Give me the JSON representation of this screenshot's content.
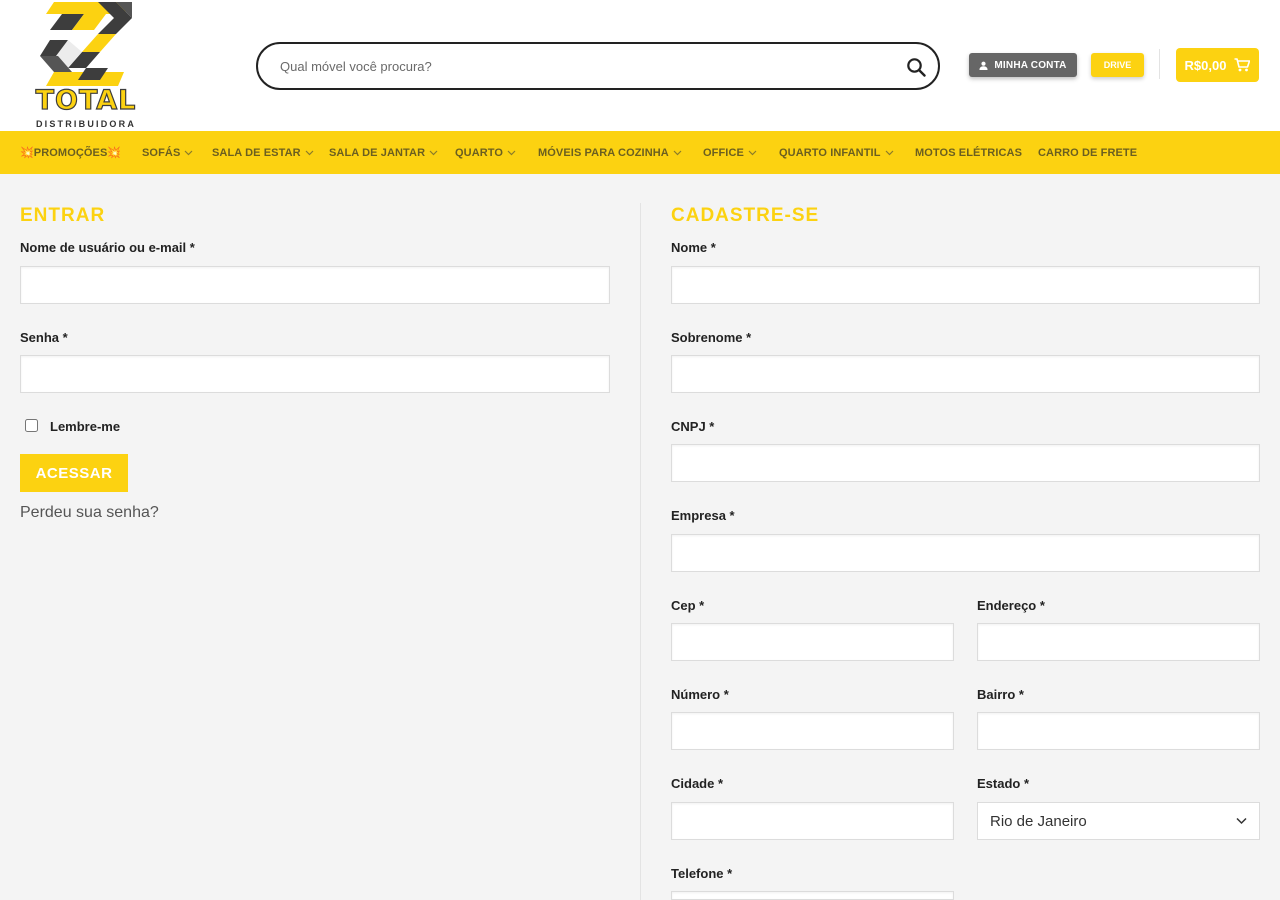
{
  "brand": {
    "name": "TOTAL",
    "tagline": "DISTRIBUIDORA",
    "colors": {
      "accent": "#fcd211",
      "dark": "#3d3d3d",
      "account_button": "#666666"
    }
  },
  "header": {
    "search_placeholder": "Qual móvel você procura?",
    "account_label": "MINHA CONTA",
    "drive_label": "DRIVE",
    "cart_total": "R$0,00"
  },
  "nav": {
    "items": [
      {
        "label": "💥PROMOÇÕES💥",
        "has_dropdown": false
      },
      {
        "label": "SOFÁS",
        "has_dropdown": true
      },
      {
        "label": "SALA DE ESTAR",
        "has_dropdown": true
      },
      {
        "label": "SALA DE JANTAR",
        "has_dropdown": true
      },
      {
        "label": "QUARTO",
        "has_dropdown": true
      },
      {
        "label": "MÓVEIS PARA COZINHA",
        "has_dropdown": true
      },
      {
        "label": "OFFICE",
        "has_dropdown": true
      },
      {
        "label": "QUARTO INFANTIL",
        "has_dropdown": true
      },
      {
        "label": "MOTOS ELÉTRICAS",
        "has_dropdown": false
      },
      {
        "label": "CARRO DE FRETE",
        "has_dropdown": false
      }
    ]
  },
  "login": {
    "title": "ENTRAR",
    "username_label": "Nome de usuário ou e-mail *",
    "username_value": "",
    "password_label": "Senha *",
    "password_value": "",
    "remember_label": "Lembre-me",
    "remember_checked": false,
    "submit_label": "ACESSAR",
    "lost_password_label": "Perdeu sua senha?"
  },
  "register": {
    "title": "CADASTRE-SE",
    "fields": {
      "nome": {
        "label": "Nome *",
        "value": ""
      },
      "sobrenome": {
        "label": "Sobrenome *",
        "value": ""
      },
      "cnpj": {
        "label": "CNPJ *",
        "value": ""
      },
      "empresa": {
        "label": "Empresa *",
        "value": ""
      },
      "cep": {
        "label": "Cep *",
        "value": ""
      },
      "endereco": {
        "label": "Endereço *",
        "value": ""
      },
      "numero": {
        "label": "Número *",
        "value": ""
      },
      "bairro": {
        "label": "Bairro *",
        "value": ""
      },
      "cidade": {
        "label": "Cidade *",
        "value": ""
      },
      "estado": {
        "label": "Estado *",
        "value": "Rio de Janeiro"
      },
      "telefone": {
        "label": "Telefone *",
        "value": ""
      }
    }
  },
  "icons": {
    "search": "search-icon",
    "account": "user-icon",
    "cart": "cart-icon",
    "dropdown": "chevron-down-icon"
  }
}
